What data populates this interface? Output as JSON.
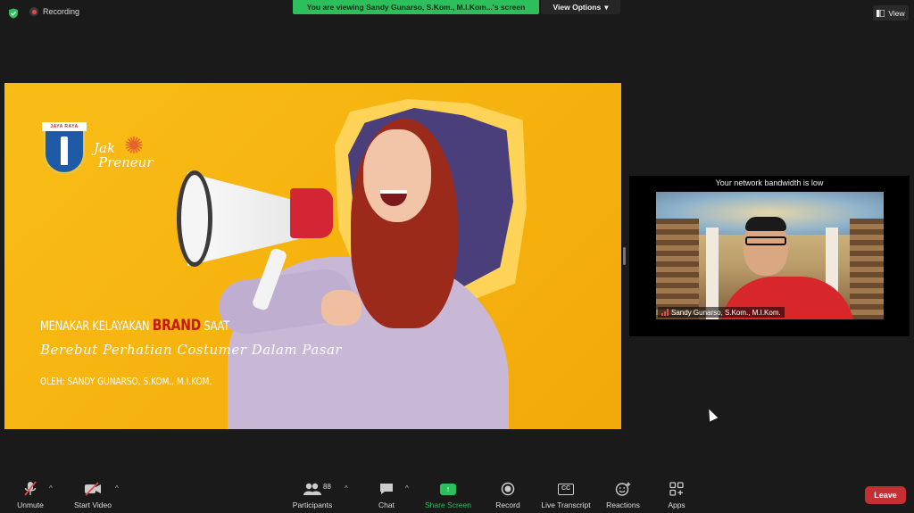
{
  "topbar": {
    "recording_label": "Recording",
    "banner_text": "You are viewing Sandy Gunarso, S.Kom., M.I.Kom...'s screen",
    "view_options_label": "View Options",
    "view_label": "View"
  },
  "slide": {
    "logo_seal_text": "JAYA RAYA",
    "logo_text_line1": "Jak",
    "logo_text_line2": "Preneur",
    "title_prefix": "MENAKAR KELAYAKAN",
    "title_brand": "BRAND",
    "title_suffix": "SAAT",
    "subtitle": "Berebut Perhatian Costumer Dalam Pasar",
    "author": "OLEH: SANDY GUNARSO, S.KOM., M.I.KOM."
  },
  "speaker": {
    "bandwidth_warning": "Your network bandwidth is low",
    "name": "Sandy Gunarso, S.Kom., M.I.Kom."
  },
  "toolbar": {
    "unmute": "Unmute",
    "start_video": "Start Video",
    "participants": "Participants",
    "participants_count": "88",
    "chat": "Chat",
    "share_screen": "Share Screen",
    "record": "Record",
    "live_transcript": "Live Transcript",
    "cc_text": "CC",
    "reactions": "Reactions",
    "apps": "Apps",
    "leave": "Leave"
  },
  "colors": {
    "banner_green": "#2dbf5c",
    "slide_yellow": "#f9bd17",
    "brand_red": "#c4161c",
    "leave_red": "#c62f32"
  }
}
